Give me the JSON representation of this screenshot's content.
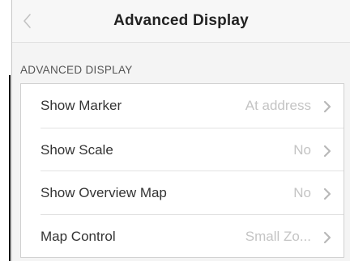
{
  "nav": {
    "title": "Advanced Display",
    "back_icon": "chevron-left-icon"
  },
  "section": {
    "header": "ADVANCED DISPLAY"
  },
  "rows": [
    {
      "label": "Show Marker",
      "value": "At address"
    },
    {
      "label": "Show Scale",
      "value": "No"
    },
    {
      "label": "Show Overview Map",
      "value": "No"
    },
    {
      "label": "Map Control",
      "value": "Small Zo..."
    }
  ],
  "colors": {
    "background": "#f4f4f4",
    "card": "#ffffff",
    "label": "#333333",
    "value": "#c4c4c4",
    "chevron": "#b8b8b8"
  }
}
